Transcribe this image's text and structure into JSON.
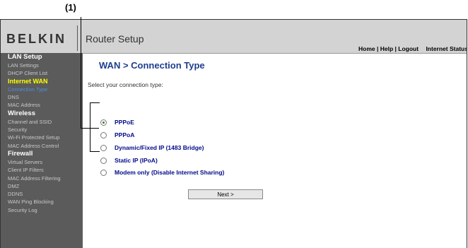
{
  "callout": {
    "label": "(1)"
  },
  "header": {
    "logo": "BELKIN",
    "title": "Router Setup",
    "links": {
      "home": "Home",
      "help": "Help",
      "logout": "Logout",
      "sep": " | "
    },
    "internet_status_label": "Internet Status:"
  },
  "sidebar": {
    "sections": [
      {
        "heading": "LAN Setup",
        "items": [
          "LAN Settings",
          "DHCP Client List"
        ]
      },
      {
        "heading": "Internet WAN",
        "items": [
          "Connection Type",
          "DNS",
          "MAC Address"
        ]
      },
      {
        "heading": "Wireless",
        "items": [
          "Channel and SSID",
          "Security",
          "Wi-Fi Protected Setup",
          "MAC Address Control"
        ]
      },
      {
        "heading": "Firewall",
        "items": [
          "Virtual Servers",
          "Client IP Filters",
          "MAC Address Filtering",
          "DMZ",
          "DDNS",
          "WAN Ping Blocking",
          "Security Log"
        ]
      }
    ],
    "active_section": "Internet WAN",
    "current_item": "Connection Type"
  },
  "main": {
    "title": "WAN > Connection Type",
    "prompt": "Select your connection type:",
    "options": [
      {
        "label": "PPPoE",
        "selected": true
      },
      {
        "label": "PPPoA",
        "selected": false
      },
      {
        "label": "Dynamic/Fixed IP (1483 Bridge)",
        "selected": false
      },
      {
        "label": "Static IP (IPoA)",
        "selected": false
      },
      {
        "label": "Modem only (Disable Internet Sharing)",
        "selected": false
      }
    ],
    "next_button": "Next >"
  }
}
